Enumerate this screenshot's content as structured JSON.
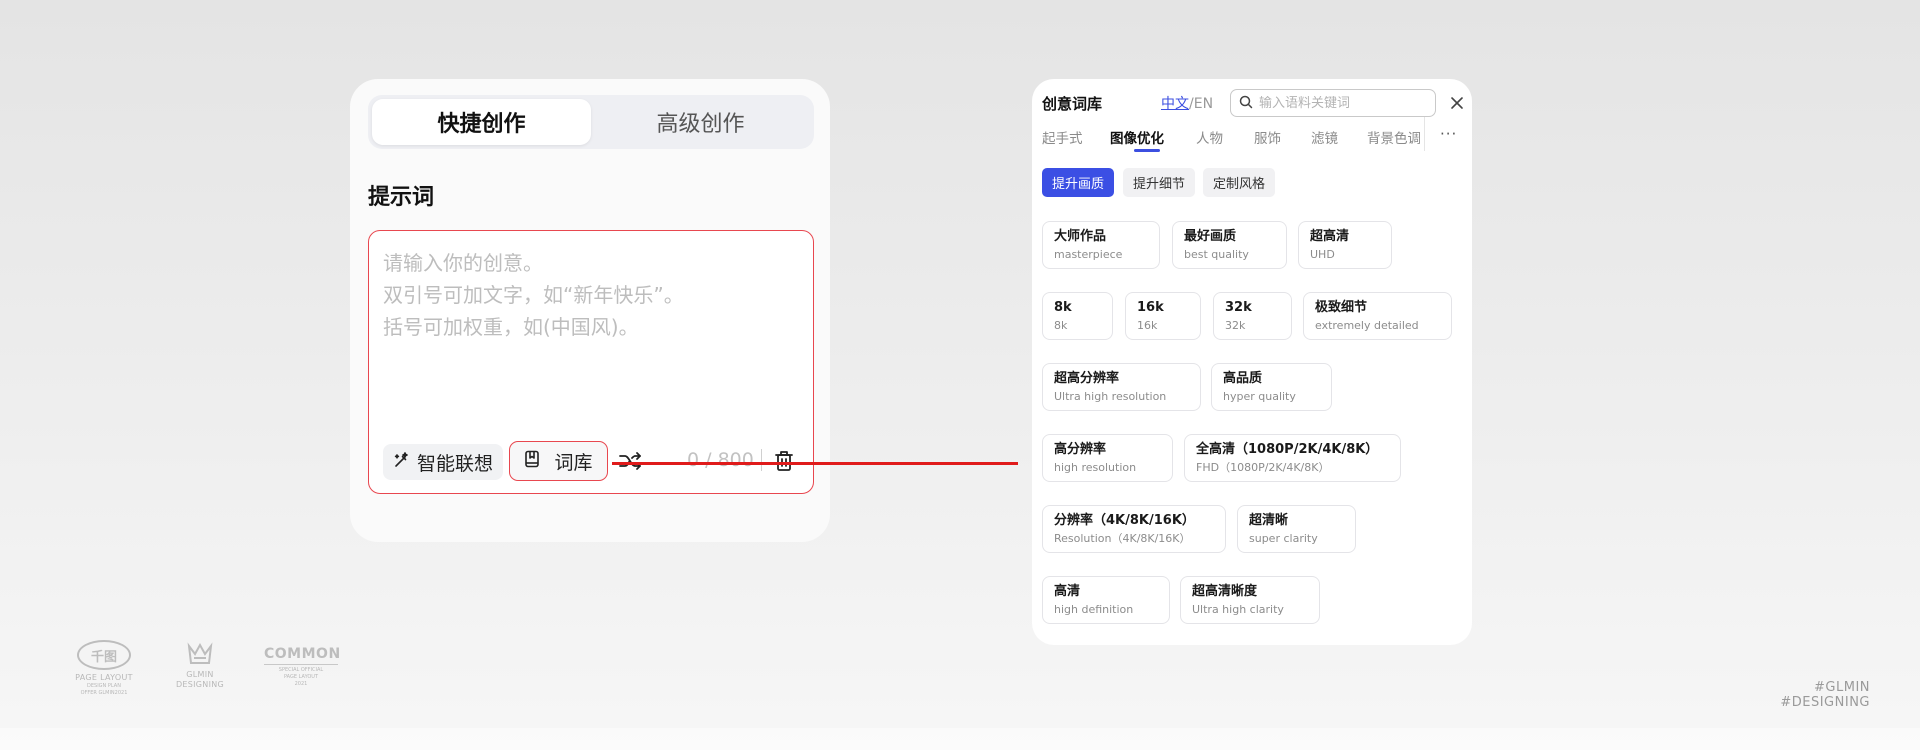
{
  "left_card": {
    "tabs": [
      {
        "label": "快捷创作",
        "active": true
      },
      {
        "label": "高级创作",
        "active": false
      }
    ],
    "prompt_title": "提示词",
    "placeholder_lines": [
      "请输入你的创意。",
      "双引号可加文字，如“新年快乐”。",
      "括号可加权重，如(中国风)。"
    ],
    "smart_button": "智能联想",
    "library_button": "词库",
    "counter": "0 / 800"
  },
  "panel": {
    "title": "创意词库",
    "lang_zh": "中文",
    "lang_sep": "/",
    "lang_en": "EN",
    "search_placeholder": "输入语料关键词",
    "categories": [
      "起手式",
      "图像优化",
      "人物",
      "服饰",
      "滤镜",
      "背景色调"
    ],
    "active_category": "图像优化",
    "more": "···",
    "subtabs": [
      "提升画质",
      "提升细节",
      "定制风格"
    ],
    "active_subtab": "提升画质",
    "chips": [
      {
        "zh": "大师作品",
        "en": "masterpiece"
      },
      {
        "zh": "最好画质",
        "en": "best quality"
      },
      {
        "zh": "超高清",
        "en": "UHD"
      },
      {
        "zh": "8k",
        "en": "8k"
      },
      {
        "zh": "16k",
        "en": "16k"
      },
      {
        "zh": "32k",
        "en": "32k"
      },
      {
        "zh": "极致细节",
        "en": "extremely detailed"
      },
      {
        "zh": "超高分辨率",
        "en": "Ultra high resolution"
      },
      {
        "zh": "高品质",
        "en": "hyper quality"
      },
      {
        "zh": "高分辨率",
        "en": "high resolution"
      },
      {
        "zh": "全高清（1080P/2K/4K/8K）",
        "en": "FHD（1080P/2K/4K/8K）"
      },
      {
        "zh": "分辨率（4K/8K/16K）",
        "en": "Resolution（4K/8K/16K）"
      },
      {
        "zh": "超清晰",
        "en": "super clarity"
      },
      {
        "zh": "高清",
        "en": "high definition"
      },
      {
        "zh": "超高清晰度",
        "en": "Ultra high clarity"
      }
    ]
  },
  "footer": {
    "logo1_mark": "千图",
    "logo1_title": "PAGE LAYOUT",
    "logo1_sub1": "DESIGN PLAN",
    "logo1_sub2": "OFFER GLMIN2021",
    "logo2_line1": "GLMIN",
    "logo2_line2": "DESIGNING",
    "logo3_title": "COMMON",
    "logo3_sub1": "SPECIAL OFFICIAL",
    "logo3_sub2": "PAGE LAYOUT",
    "logo3_sub3": "2021",
    "tag_line1": "#GLMIN",
    "tag_line2": "#DESIGNING"
  },
  "colors": {
    "accent": "#3b4fe4",
    "highlight_red": "#e8474f",
    "connector_red": "#e01b1b"
  }
}
